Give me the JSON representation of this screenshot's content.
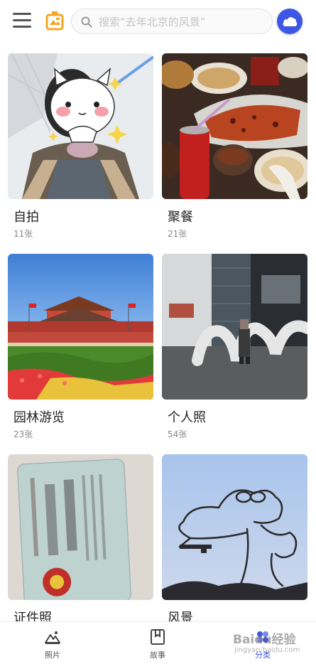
{
  "header": {
    "search_placeholder": "搜索“去年北京的风景”",
    "accent_color": "#3e56e6",
    "logo_color": "#f5a623",
    "icons": {
      "menu": "hamburger-menu-icon",
      "logo": "album-logo-icon",
      "search": "search-icon",
      "cloud": "cloud-icon"
    }
  },
  "albums": [
    {
      "title": "自拍",
      "count": "11张",
      "thumb": "selfie-photo"
    },
    {
      "title": "聚餐",
      "count": "21张",
      "thumb": "dining-table-photo"
    },
    {
      "title": "园林游览",
      "count": "23张",
      "thumb": "tiananmen-garden-photo"
    },
    {
      "title": "个人照",
      "count": "54张",
      "thumb": "person-with-sculpture-photo"
    },
    {
      "title": "证件照",
      "count": "",
      "thumb": "id-card-photo"
    },
    {
      "title": "风景",
      "count": "",
      "thumb": "crocodile-drawing-sky-photo"
    }
  ],
  "bottom_nav": {
    "items": [
      {
        "label": "照片",
        "icon": "mountain-photo-icon",
        "active": false
      },
      {
        "label": "故事",
        "icon": "story-book-icon",
        "active": false
      },
      {
        "label": "分类",
        "icon": "category-icon",
        "active": true
      }
    ],
    "watermark": {
      "text": "Baidu经验",
      "sub": "jingyan.baidu.com"
    }
  }
}
